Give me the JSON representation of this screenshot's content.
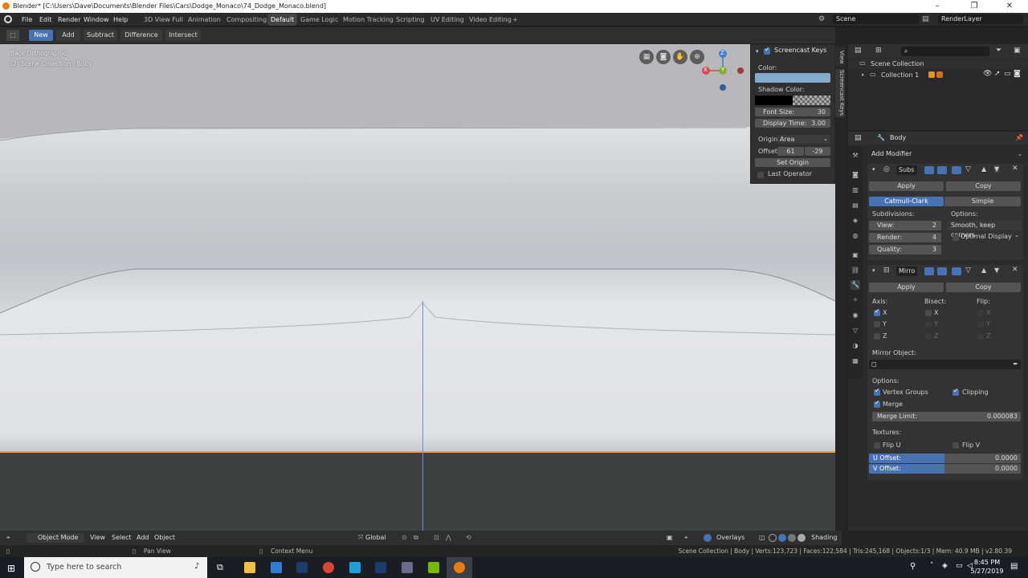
{
  "window": {
    "title": "Blender* [C:\\Users\\Dave\\Documents\\Blender Files\\Cars\\Dodge_Monaco\\74_Dodge_Monaco.blend]",
    "minimize": "–",
    "maximize": "❐",
    "close": "✕"
  },
  "menu": [
    "File",
    "Edit",
    "Render",
    "Window",
    "Help"
  ],
  "workspaces": [
    "3D View Full",
    "Animation",
    "Compositing",
    "Default",
    "Game Logic",
    "Motion Tracking",
    "Scripting",
    "UV Editing",
    "Video Editing"
  ],
  "workspace_add": "+",
  "active_workspace": "Default",
  "scene": {
    "name": "Scene",
    "render_layer": "RenderLayer"
  },
  "tool_header": {
    "modes": [
      "New",
      "Add",
      "Subtract",
      "Difference",
      "Intersect"
    ],
    "active": "New"
  },
  "viewport": {
    "view_name": "Back Orthographic",
    "collection_path": "(2) Scene Collection | Body",
    "gizmo": {
      "z": "Z",
      "y": "Y",
      "x": "X"
    }
  },
  "screencast": {
    "title": "Screencast Keys",
    "color_label": "Color:",
    "color_value": "#86aacb",
    "shadow_label": "Shadow Color:",
    "font_size_label": "Font Size:",
    "font_size": "30",
    "display_time_label": "Display Time:",
    "display_time": "3.00",
    "origin_label": "Origin:",
    "origin_value": "Area",
    "offset_label": "Offset:",
    "offset_x": "61",
    "offset_y": "-29",
    "set_origin": "Set Origin",
    "last_operator": "Last Operator"
  },
  "sidebar_tabs": [
    "View",
    "Screencast Keys"
  ],
  "outliner": {
    "root": "Scene Collection",
    "child": "Collection 1"
  },
  "properties": {
    "object_name": "Body",
    "add_modifier": "Add Modifier",
    "subsurf": {
      "name": "Subs",
      "apply": "Apply",
      "copy": "Copy",
      "type_a": "Catmull-Clark",
      "type_b": "Simple",
      "subdivisions_label": "Subdivisions:",
      "options_label": "Options:",
      "view_label": "View:",
      "view_value": "2",
      "render_label": "Render:",
      "render_value": "4",
      "quality_label": "Quality:",
      "quality_value": "3",
      "uv_option": "Smooth, keep corners",
      "optimal_display": "Optimal Display"
    },
    "mirror": {
      "name": "Mirro",
      "apply": "Apply",
      "copy": "Copy",
      "axis_label": "Axis:",
      "bisect_label": "Bisect:",
      "flip_label": "Flip:",
      "x": "X",
      "y": "Y",
      "z": "Z",
      "mirror_object_label": "Mirror Object:",
      "options_label": "Options:",
      "vertex_groups": "Vertex Groups",
      "clipping": "Clipping",
      "merge": "Merge",
      "merge_limit_label": "Merge Limit:",
      "merge_limit_value": "0.000083",
      "textures_label": "Textures:",
      "flip_u": "Flip U",
      "flip_v": "Flip V",
      "u_offset_label": "U Offset:",
      "u_offset_value": "0.0000",
      "v_offset_label": "V Offset:",
      "v_offset_value": "0.0000"
    }
  },
  "viewport_header": {
    "mode": "Object Mode",
    "menus": [
      "View",
      "Select",
      "Add",
      "Object"
    ],
    "orientation": "Global",
    "overlays": "Overlays",
    "shading": "Shading"
  },
  "status": {
    "left": "Pan View",
    "middle": "Context Menu",
    "right": "Scene Collection | Body | Verts:123,723 | Faces:122,584 | Tris:245,168 | Objects:1/3 | Mem: 40.9 MB | v2.80.39"
  },
  "taskbar": {
    "search_placeholder": "Type here to search",
    "time": "8:45 PM",
    "date": "5/27/2019"
  }
}
